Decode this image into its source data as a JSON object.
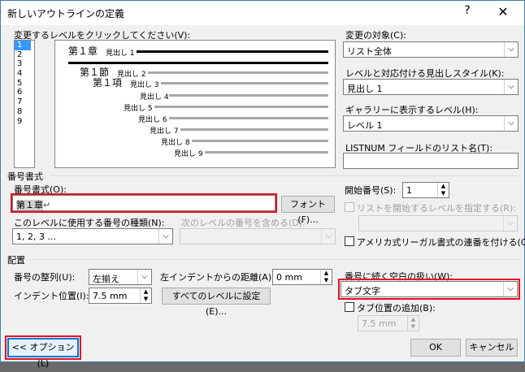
{
  "window": {
    "title": "新しいアウトラインの定義",
    "help": "?",
    "close": "✕"
  },
  "levels": {
    "label": "変更するレベルをクリックしてください(V):",
    "items": [
      "1",
      "2",
      "3",
      "4",
      "5",
      "6",
      "7",
      "8",
      "9"
    ],
    "selected_index": 0
  },
  "preview": {
    "rows": [
      {
        "number": "第１章",
        "text": "見出し 1"
      },
      {
        "number": "",
        "text": ""
      },
      {
        "number": "第１節",
        "text": "見出し 2"
      },
      {
        "number": "第１項",
        "text": "見出し 3"
      },
      {
        "number": "",
        "text": "見出し 4"
      },
      {
        "number": "",
        "text": "見出し 5"
      },
      {
        "number": "",
        "text": "見出し 6"
      },
      {
        "number": "",
        "text": "見出し 7"
      },
      {
        "number": "",
        "text": "見出し 8"
      },
      {
        "number": "",
        "text": "見出し 9"
      }
    ]
  },
  "apply_to": {
    "label": "変更の対象(C):",
    "value": "リスト全体"
  },
  "link_style": {
    "label": "レベルと対応付ける見出しスタイル(K):",
    "value": "見出し 1"
  },
  "gallery_level": {
    "label": "ギャラリーに表示するレベル(H):",
    "value": "レベル 1"
  },
  "listnum": {
    "label": "LISTNUM フィールドのリスト名(T):",
    "value": ""
  },
  "number_format": {
    "section_label": "番号書式",
    "label": "番号書式(O):",
    "value": "第１章",
    "para_mark": "↵",
    "font_button": "フォント(F)...",
    "style_label": "このレベルに使用する番号の種類(N):",
    "style_value": "1, 2, 3 ...",
    "include_label": "次のレベルの番号を含める(D):",
    "include_value": ""
  },
  "start_at": {
    "label": "開始番号(S):",
    "value": "1",
    "restart_label": "リストを開始するレベルを指定する(R):",
    "restart_value": "",
    "legal_label": "アメリカ式リーガル書式の連番を付ける(G)"
  },
  "position": {
    "section_label": "配置",
    "alignment_label": "番号の整列(U):",
    "alignment_value": "左揃え",
    "aligned_at_label": "左インデントからの距離(A):",
    "aligned_at_value": "0 mm",
    "indent_label": "インデント位置(I):",
    "indent_value": "7.5 mm",
    "set_all_button": "すべてのレベルに設定(E)...",
    "follow_label": "番号に続く空白の扱い(W):",
    "follow_value": "タブ文字",
    "tab_stop_label": "タブ位置の追加(B):",
    "tab_stop_value": "7.5 mm"
  },
  "buttons": {
    "options": "<< オプション(L)",
    "ok": "OK",
    "cancel": "キャンセル"
  }
}
